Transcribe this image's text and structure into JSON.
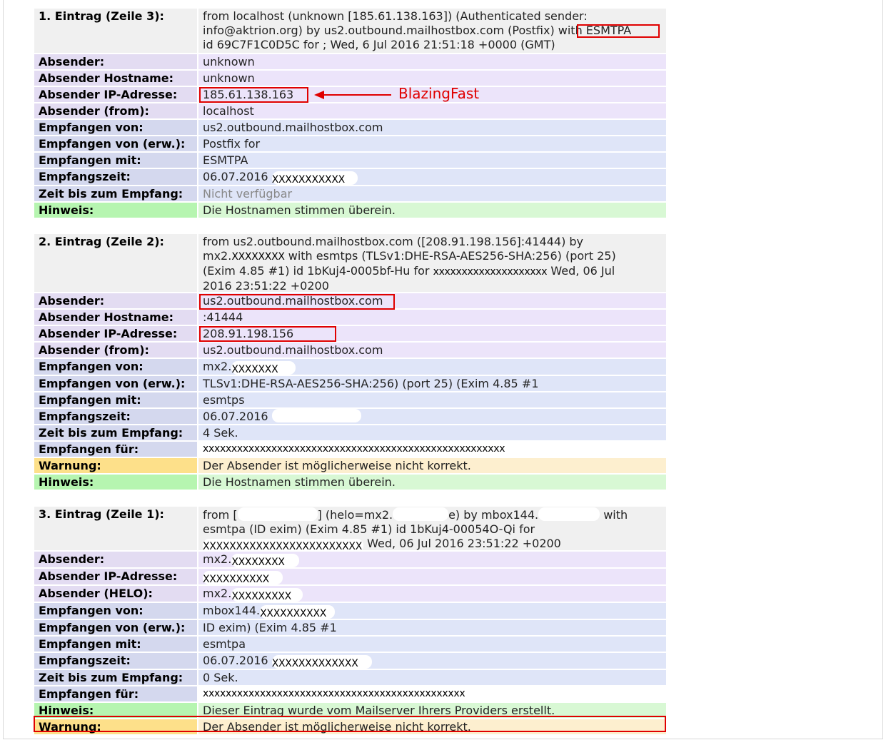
{
  "entry1": {
    "title": "1. Eintrag (Zeile 3):",
    "header": [
      "from localhost (unknown [185.61.138.163]) (Authenticated sender:",
      "info@aktrion.org) by us2.outbound.mailhostbox.com (Postfix) with ESMTPA",
      "id 69C7F1C0D5C for ; Wed, 6 Jul 2016 21:51:18 +0000 (GMT)"
    ],
    "rows": [
      {
        "label": "Absender:",
        "value": "unknown"
      },
      {
        "label": "Absender Hostname:",
        "value": "unknown"
      },
      {
        "label": "Absender IP-Adresse:",
        "value": "185.61.138.163"
      },
      {
        "label": "Absender (from):",
        "value": "localhost"
      },
      {
        "label": "Empfangen von:",
        "value": "us2.outbound.mailhostbox.com"
      },
      {
        "label": "Empfangen von (erw.):",
        "value": "Postfix for"
      },
      {
        "label": "Empfangen mit:",
        "value": "ESMTPA"
      },
      {
        "label": "Empfangszeit:",
        "value": "06.07.2016",
        "mask": "XXXXXXXXXXX"
      },
      {
        "label": "Zeit bis zum Empfang:",
        "value": "Nicht verfügbar"
      },
      {
        "label": "Hinweis:",
        "value": "Die Hostnamen stimmen überein."
      }
    ]
  },
  "entry2": {
    "title": "2. Eintrag (Zeile 2):",
    "header": [
      "from us2.outbound.mailhostbox.com ([208.91.198.156]:41444) by",
      "mx2.",
      "XXXXXXXX",
      "with esmtps (TLSv1:DHE-RSA-AES256-SHA:256) (port 25)",
      "(Exim 4.85 #1) id 1bKuj4-0005bf-Hu for",
      "xxxxxxxxxxxxxxxxxxxx",
      "Wed, 06 Jul",
      "2016 23:51:22 +0200"
    ],
    "rows": [
      {
        "label": "Absender:",
        "value": "us2.outbound.mailhostbox.com"
      },
      {
        "label": "Absender Hostname:",
        "value": ":41444"
      },
      {
        "label": "Absender IP-Adresse:",
        "value": "208.91.198.156"
      },
      {
        "label": "Absender (from):",
        "value": "us2.outbound.mailhostbox.com"
      },
      {
        "label": "Empfangen von:",
        "value": "mx2.",
        "mask": "XXXXXXX"
      },
      {
        "label": "Empfangen von (erw.):",
        "value": "TLSv1:DHE-RSA-AES256-SHA:256) (port 25) (Exim 4.85 #1"
      },
      {
        "label": "Empfangen mit:",
        "value": "esmtps"
      },
      {
        "label": "Empfangszeit:",
        "value": "06.07.2016"
      },
      {
        "label": "Zeit bis zum Empfang:",
        "value": "4 Sek."
      },
      {
        "label": "Empfangen für:",
        "value": "xxxxxxxxxxxxxxxxxxxxxxxxxxxxxxxxxxxxxxxxxxxxxxxxxxxxx"
      },
      {
        "label": "Warnung:",
        "value": "Der Absender ist möglicherweise nicht korrekt."
      },
      {
        "label": "Hinweis:",
        "value": "Die Hostnamen stimmen überein."
      }
    ]
  },
  "entry3": {
    "title": "3. Eintrag (Zeile 1):",
    "header": [
      "from [",
      "] (helo=mx2.",
      "e) by mbox144.",
      "with",
      "esmtpa (ID exim) (Exim 4.85 #1) id 1bKuj4-00054O-Qi for",
      "XXXXXXXXXXXXXXXXXXXXXXXX",
      "Wed, 06 Jul 2016 23:51:22 +0200"
    ],
    "rows": [
      {
        "label": "Absender:",
        "value": "mx2.",
        "mask": "XXXXXXXX"
      },
      {
        "label": "Absender IP-Adresse:",
        "value": "",
        "mask": "XXXXXXXXXX"
      },
      {
        "label": "Absender (HELO):",
        "value": "mx2.",
        "mask": "XXXXXXXXX"
      },
      {
        "label": "Empfangen von:",
        "value": "mbox144.",
        "mask": "XXXXXXXXXX"
      },
      {
        "label": "Empfangen von (erw.):",
        "value": "ID exim) (Exim 4.85 #1"
      },
      {
        "label": "Empfangen mit:",
        "value": "esmtpa"
      },
      {
        "label": "Empfangszeit:",
        "value": "06.07.2016",
        "mask": "XXXXXXXXXXXXX"
      },
      {
        "label": "Zeit bis zum Empfang:",
        "value": "0 Sek."
      },
      {
        "label": "Empfangen für:",
        "value": "xxxxxxxxxxxxxxxxxxxxxxxxxxxxxxxxxxxxxxxxxxxxxx"
      },
      {
        "label": "Hinweis:",
        "value": "Dieser Eintrag wurde vom Mailserver Ihrers Providers erstellt."
      },
      {
        "label": "Warnung:",
        "value": "Der Absender ist möglicherweise nicht korrekt."
      }
    ]
  },
  "annotation": {
    "text": "BlazingFast",
    "color": "#e00000"
  }
}
